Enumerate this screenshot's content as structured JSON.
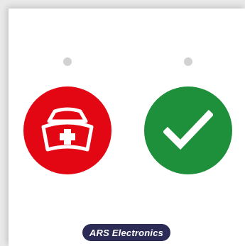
{
  "icons": {
    "left": {
      "name": "nurse-cap-icon",
      "color": "#e30613"
    },
    "right": {
      "name": "checkmark-icon",
      "color": "#1e8f3b"
    }
  },
  "brand": {
    "label": "ARS Electronics",
    "background": "#2b2b55"
  }
}
